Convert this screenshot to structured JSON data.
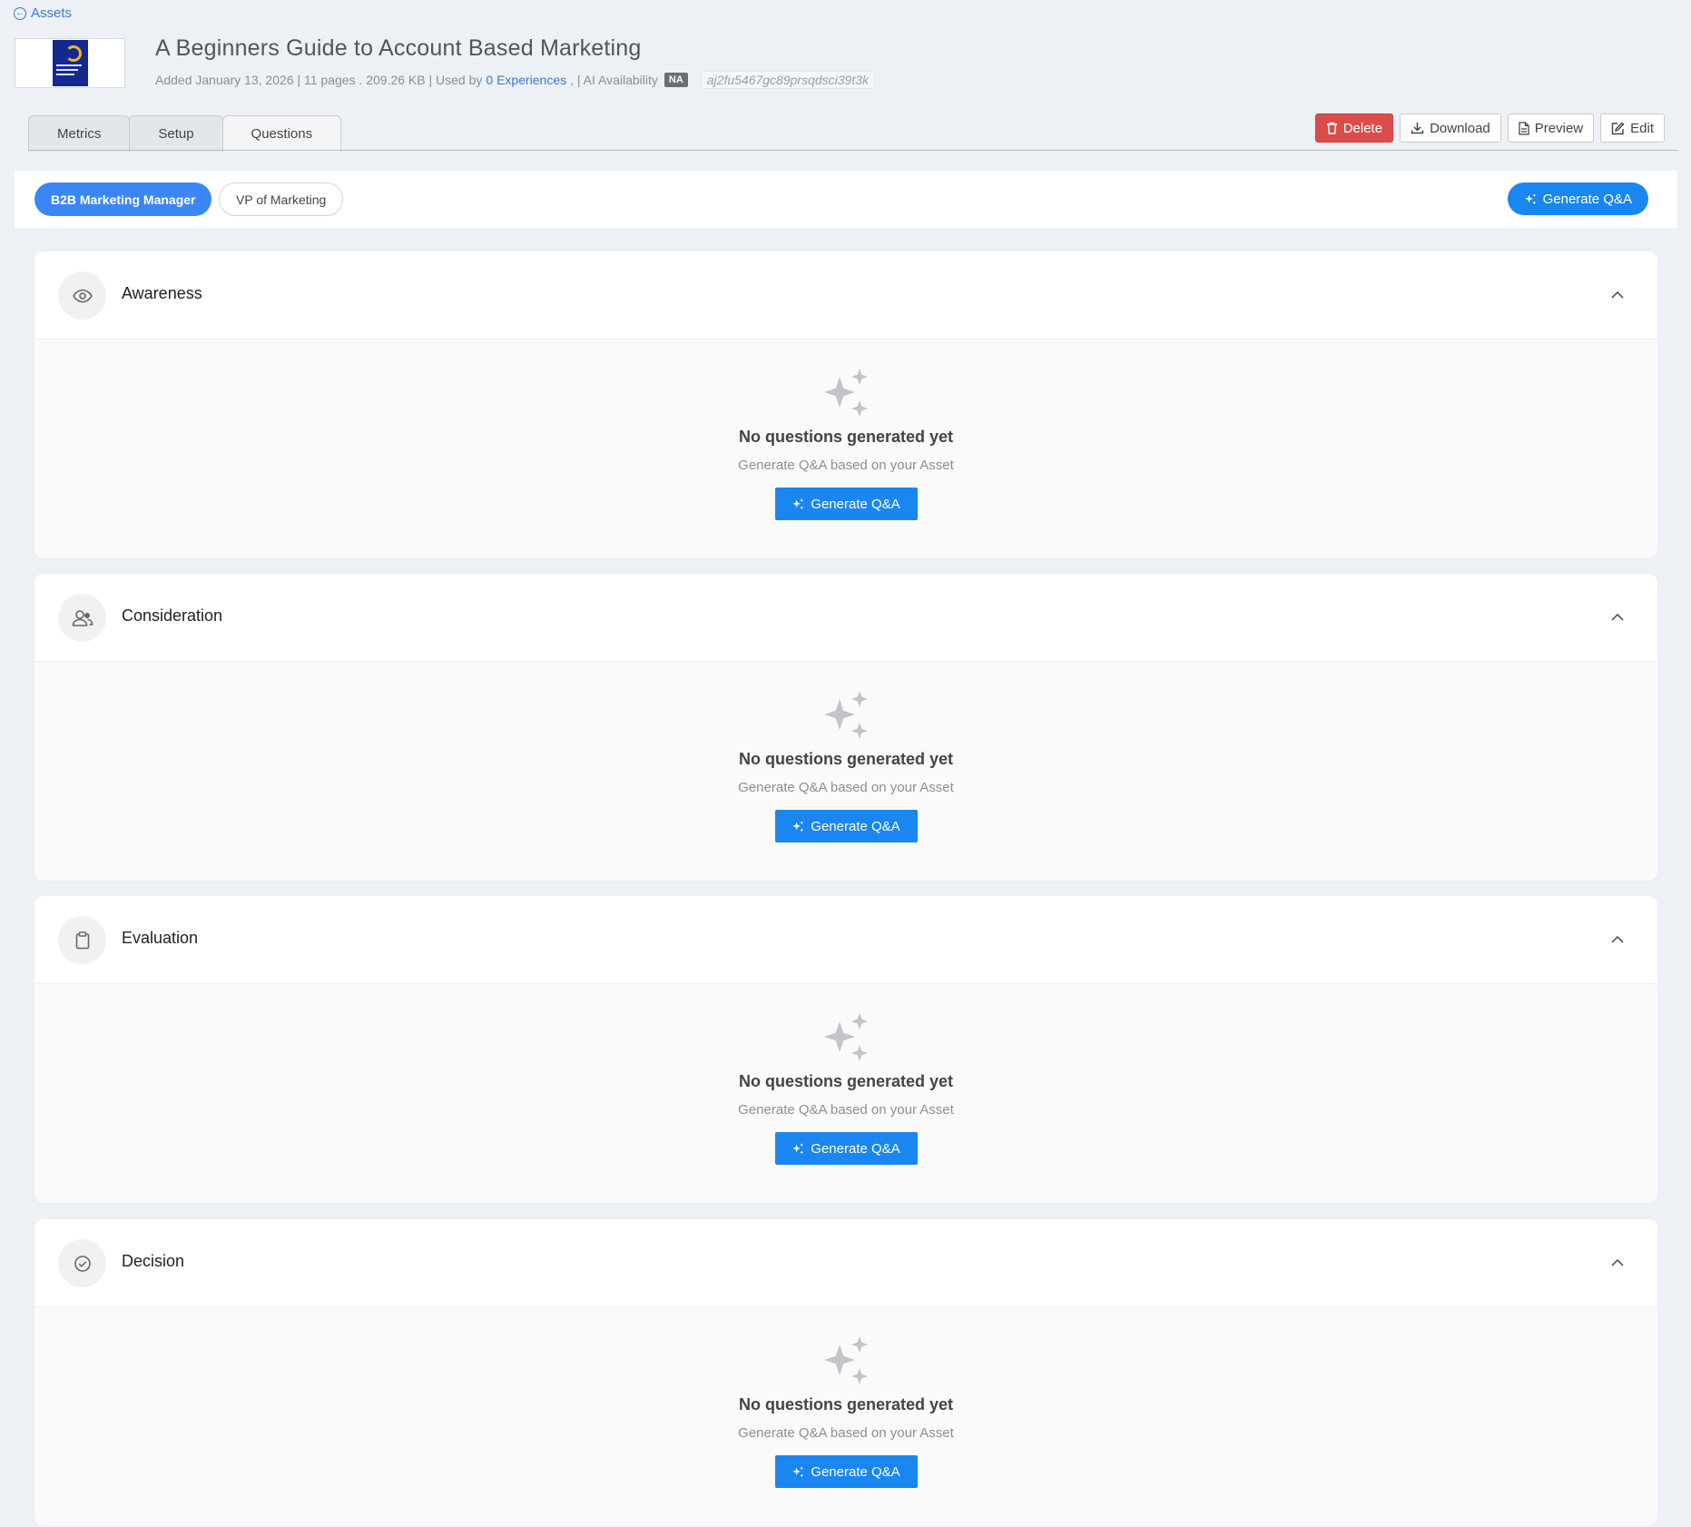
{
  "breadcrumb": {
    "back_label": "Assets"
  },
  "asset": {
    "title": "A Beginners Guide to Account Based Marketing",
    "added": "Added January 13, 2026 | 11 pages . 209.26 KB | Used by",
    "experiences_link": "0 Experiences",
    "ai_label": ", | AI Availability",
    "ai_badge": "NA",
    "hash": "aj2fu5467gc89prsqdsci39t3k"
  },
  "tabs": [
    {
      "label": "Metrics"
    },
    {
      "label": "Setup"
    },
    {
      "label": "Questions",
      "active": true
    }
  ],
  "actions": {
    "delete": "Delete",
    "download": "Download",
    "preview": "Preview",
    "edit": "Edit"
  },
  "personas": [
    {
      "label": "B2B Marketing Manager",
      "active": true
    },
    {
      "label": "VP of Marketing",
      "active": false
    }
  ],
  "generate_top": "Generate Q&A",
  "sections": [
    {
      "title": "Awareness",
      "icon": "eye-icon",
      "empty_title": "No questions generated yet",
      "empty_sub": "Generate Q&A based on your Asset",
      "button": "Generate Q&A"
    },
    {
      "title": "Consideration",
      "icon": "users-icon",
      "empty_title": "No questions generated yet",
      "empty_sub": "Generate Q&A based on your Asset",
      "button": "Generate Q&A"
    },
    {
      "title": "Evaluation",
      "icon": "clipboard-icon",
      "empty_title": "No questions generated yet",
      "empty_sub": "Generate Q&A based on your Asset",
      "button": "Generate Q&A"
    },
    {
      "title": "Decision",
      "icon": "check-circle-icon",
      "empty_title": "No questions generated yet",
      "empty_sub": "Generate Q&A based on your Asset",
      "button": "Generate Q&A"
    }
  ],
  "colors": {
    "primary": "#1a86f0",
    "persona_active": "#3a86f5",
    "danger": "#db4c4c",
    "background": "#edf0f4"
  }
}
